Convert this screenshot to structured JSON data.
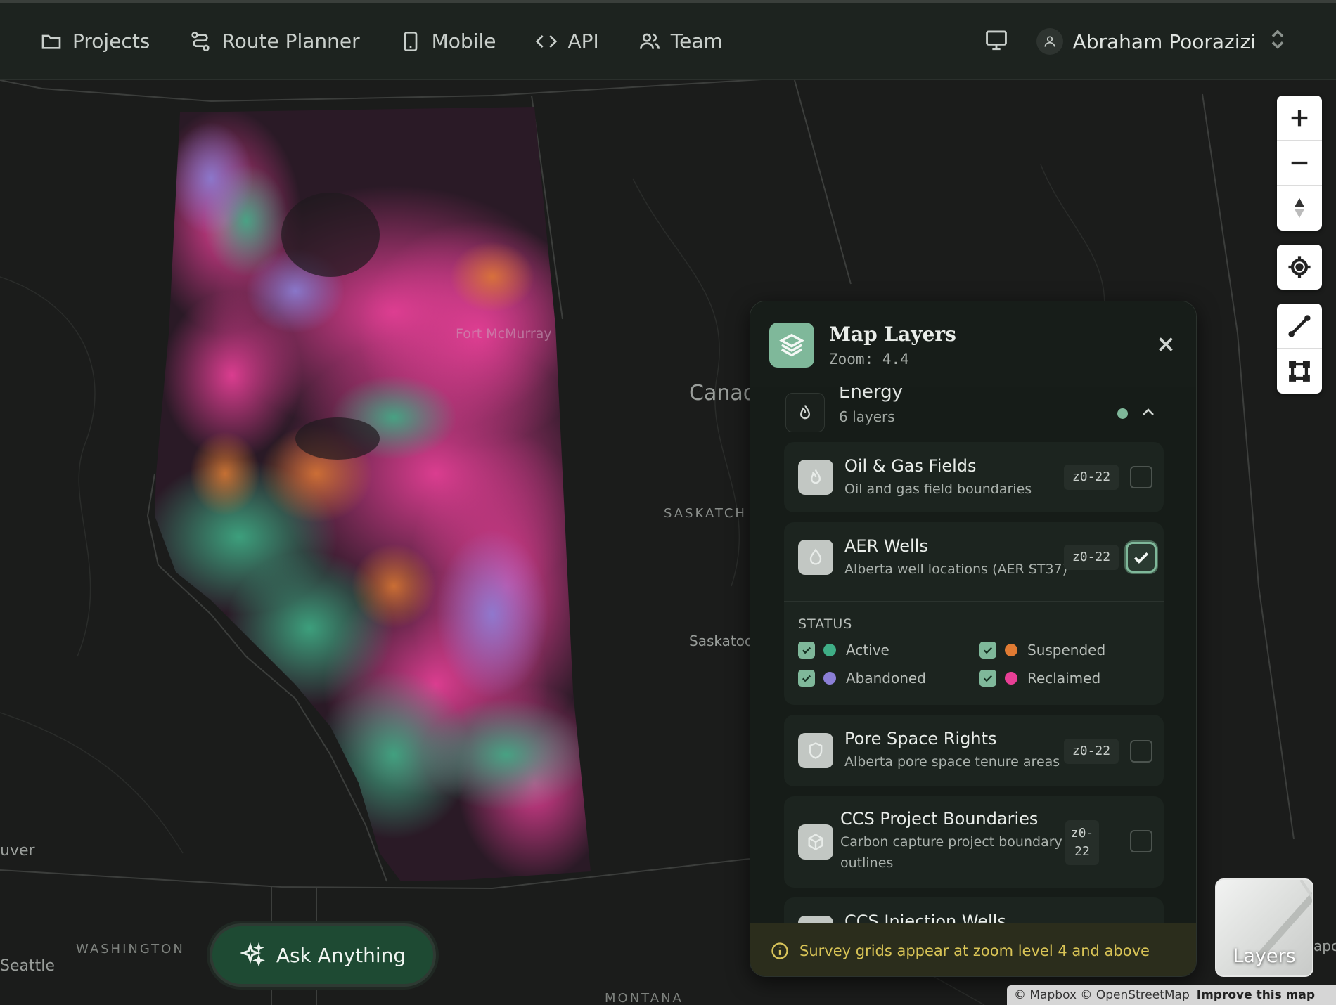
{
  "nav": {
    "items": [
      {
        "label": "Projects",
        "icon": "folder-icon"
      },
      {
        "label": "Route Planner",
        "icon": "route-icon"
      },
      {
        "label": "Mobile",
        "icon": "mobile-icon"
      },
      {
        "label": "API",
        "icon": "code-icon"
      },
      {
        "label": "Team",
        "icon": "team-icon"
      }
    ],
    "user_name": "Abraham Poorazizi"
  },
  "map_labels": {
    "canada": "Canad",
    "saskatchewan": "SASKATCH",
    "saskatoon": "Saskatoo",
    "washington": "WASHINGTON",
    "seattle": "Seattle",
    "vancouver": "uver",
    "montana": "MONTANA",
    "fort_mcmurray": "Fort McMurray",
    "edge_right": "apo"
  },
  "panel": {
    "title": "Map Layers",
    "zoom": "Zoom: 4.4",
    "group": {
      "name": "Energy",
      "count": "6 layers"
    },
    "layers": [
      {
        "title": "Oil & Gas Fields",
        "subtitle": "Oil and gas field boundaries",
        "zoom": "z0-22",
        "checked": false
      },
      {
        "title": "AER Wells",
        "subtitle": "Alberta well locations (AER ST37)",
        "zoom": "z0-22",
        "checked": true
      },
      {
        "title": "Pore Space Rights",
        "subtitle": "Alberta pore space tenure areas",
        "zoom": "z0-22",
        "checked": false
      },
      {
        "title": "CCS Project Boundaries",
        "subtitle": "Carbon capture project boundary outlines",
        "zoom_line1": "z0-",
        "zoom_line2": "22",
        "checked": false
      },
      {
        "title": "CCS Injection Wells"
      }
    ],
    "status": {
      "title": "STATUS",
      "items": [
        {
          "label": "Active",
          "color": "#3fae86"
        },
        {
          "label": "Suspended",
          "color": "#e07b33"
        },
        {
          "label": "Abandoned",
          "color": "#8b7fd6"
        },
        {
          "label": "Reclaimed",
          "color": "#e83f95"
        }
      ]
    },
    "footer_notice": "Survey grids appear at zoom level 4 and above"
  },
  "ask_label": "Ask Anything",
  "layers_label": "Layers",
  "attribution": {
    "mapbox": "© Mapbox",
    "osm": "© OpenStreetMap",
    "improve": "Improve this map"
  },
  "colors": {
    "accent": "#7fb89a",
    "notice": "#d9c456"
  }
}
